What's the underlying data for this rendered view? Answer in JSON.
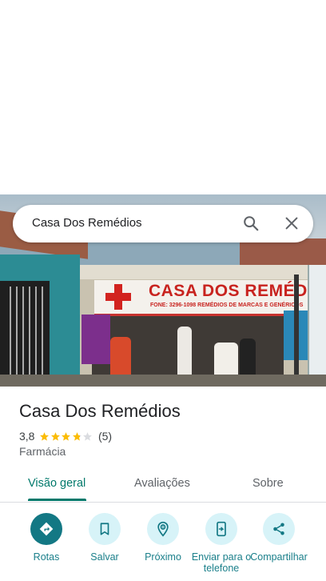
{
  "search": {
    "query": "Casa Dos Remédios"
  },
  "photo": {
    "sign_text": "CASA DOS REMÉDIOS",
    "sign_subtext": "FONE: 3296-1098    REMÉDIOS DE MARCAS E GENÉRICOS"
  },
  "place": {
    "title": "Casa Dos Remédios",
    "rating": "3,8",
    "stars": 3.8,
    "review_count": "(5)",
    "category": "Farmácia"
  },
  "tabs": [
    {
      "label": "Visão geral",
      "active": true
    },
    {
      "label": "Avaliações",
      "active": false
    },
    {
      "label": "Sobre",
      "active": false
    }
  ],
  "actions": [
    {
      "label": "Rotas",
      "icon": "directions-icon"
    },
    {
      "label": "Salvar",
      "icon": "bookmark-icon"
    },
    {
      "label": "Próximo",
      "icon": "nearby-icon"
    },
    {
      "label": "Enviar para o telefone",
      "icon": "send-to-phone-icon"
    },
    {
      "label": "Compartilhar",
      "icon": "share-icon"
    }
  ],
  "colors": {
    "accent": "#00796b",
    "action_primary": "#137884",
    "action_secondary": "#d7f3f8",
    "star": "#fbbc04"
  }
}
